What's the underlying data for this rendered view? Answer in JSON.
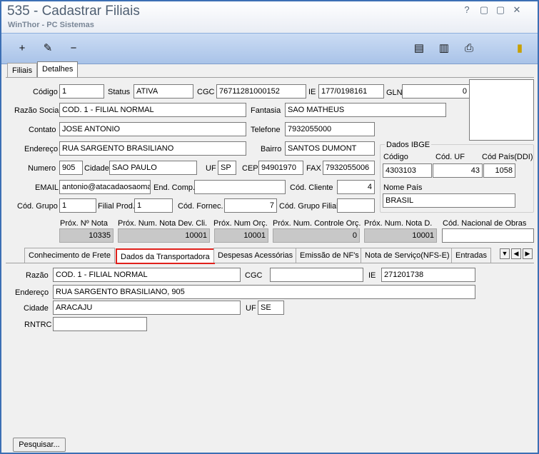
{
  "window": {
    "title": "535 - Cadastrar Filiais",
    "subtitle": "WinThor - PC Sistemas",
    "help": "?",
    "minimize": "▢",
    "maximize": "▢",
    "close": "✕"
  },
  "toolbar": {
    "add": "+",
    "edit": "✎",
    "remove": "−",
    "copy": "▤",
    "clipboard": "▥",
    "print": "⎙",
    "exit": "▮"
  },
  "tabs": [
    "Filiais",
    "Detalhes"
  ],
  "form": {
    "codigo_label": "Código",
    "codigo": "1",
    "status_label": "Status",
    "status": "ATIVA",
    "cgc_label": "CGC",
    "cgc": "76711281000152",
    "ie_label": "IE",
    "ie": "177/0198161",
    "gln_label": "GLN",
    "gln": "0",
    "razao_label": "Razão Social",
    "razao": "COD. 1 - FILIAL NORMAL",
    "fantasia_label": "Fantasia",
    "fantasia": "SAO MATHEUS",
    "contato_label": "Contato",
    "contato": "JOSE ANTONIO",
    "telefone_label": "Telefone",
    "telefone": "7932055000",
    "endereco_label": "Endereço",
    "endereco": "RUA SARGENTO BRASILIANO",
    "bairro_label": "Bairro",
    "bairro": "SANTOS DUMONT",
    "numero_label": "Numero",
    "numero": "905",
    "cidade_label": "Cidade",
    "cidade": "SAO PAULO",
    "uf_label": "UF",
    "uf": "SP",
    "cep_label": "CEP",
    "cep": "94901970",
    "fax_label": "FAX",
    "fax": "7932055006",
    "email_label": "EMAIL",
    "email": "antonio@atacadaosaomat",
    "endcomp_label": "End. Comp.",
    "endcomp": "",
    "codcliente_label": "Cód. Cliente",
    "codcliente": "4",
    "codgrupo_label": "Cód. Grupo",
    "codgrupo": "1",
    "filialprod_label": "Filial Prod.",
    "filialprod": "1",
    "codfornec_label": "Cód. Fornec.",
    "codfornec": "7",
    "codgrupofilial_label": "Cód. Grupo Filial",
    "codgrupofilial": ""
  },
  "ibge": {
    "title": "Dados IBGE",
    "codigo_label": "Código",
    "codigo": "4303103",
    "coduf_label": "Cód. UF",
    "coduf": "43",
    "codpais_label": "Cód País(DDI)",
    "codpais": "1058",
    "nomepais_label": "Nome País",
    "nomepais": "BRASIL"
  },
  "prox": {
    "nota_label": "Próx. Nº Nota",
    "nota": "10335",
    "notadev_label": "Próx. Num. Nota Dev. Cli.",
    "notadev": "10001",
    "orc_label": "Próx. Num Orç.",
    "orc": "10001",
    "ctrlorc_label": "Próx. Num. Controle Orç.",
    "ctrlorc": "0",
    "notad_label": "Próx. Num. Nota D.",
    "notad": "10001",
    "obras_label": "Cód. Nacional de Obras",
    "obras": ""
  },
  "subtabs": [
    "Conhecimento de Frete",
    "Dados da Transportadora",
    "Despesas Acessórias",
    "Emissão de NF's",
    "Nota de Serviço(NFS-E)",
    "Entradas"
  ],
  "arrows": {
    "down": "▼",
    "left": "◀",
    "right": "▶"
  },
  "transp": {
    "razao_label": "Razão",
    "razao": "COD. 1 - FILIAL NORMAL",
    "cgc_label": "CGC",
    "cgc": "",
    "ie_label": "IE",
    "ie": "271201738",
    "endereco_label": "Endereço",
    "endereco": "RUA SARGENTO BRASILIANO, 905",
    "cidade_label": "Cidade",
    "cidade": "ARACAJU",
    "uf_label": "UF",
    "uf": "SE",
    "rntrc_label": "RNTRC",
    "rntrc": ""
  },
  "search_button": "Pesquisar..."
}
